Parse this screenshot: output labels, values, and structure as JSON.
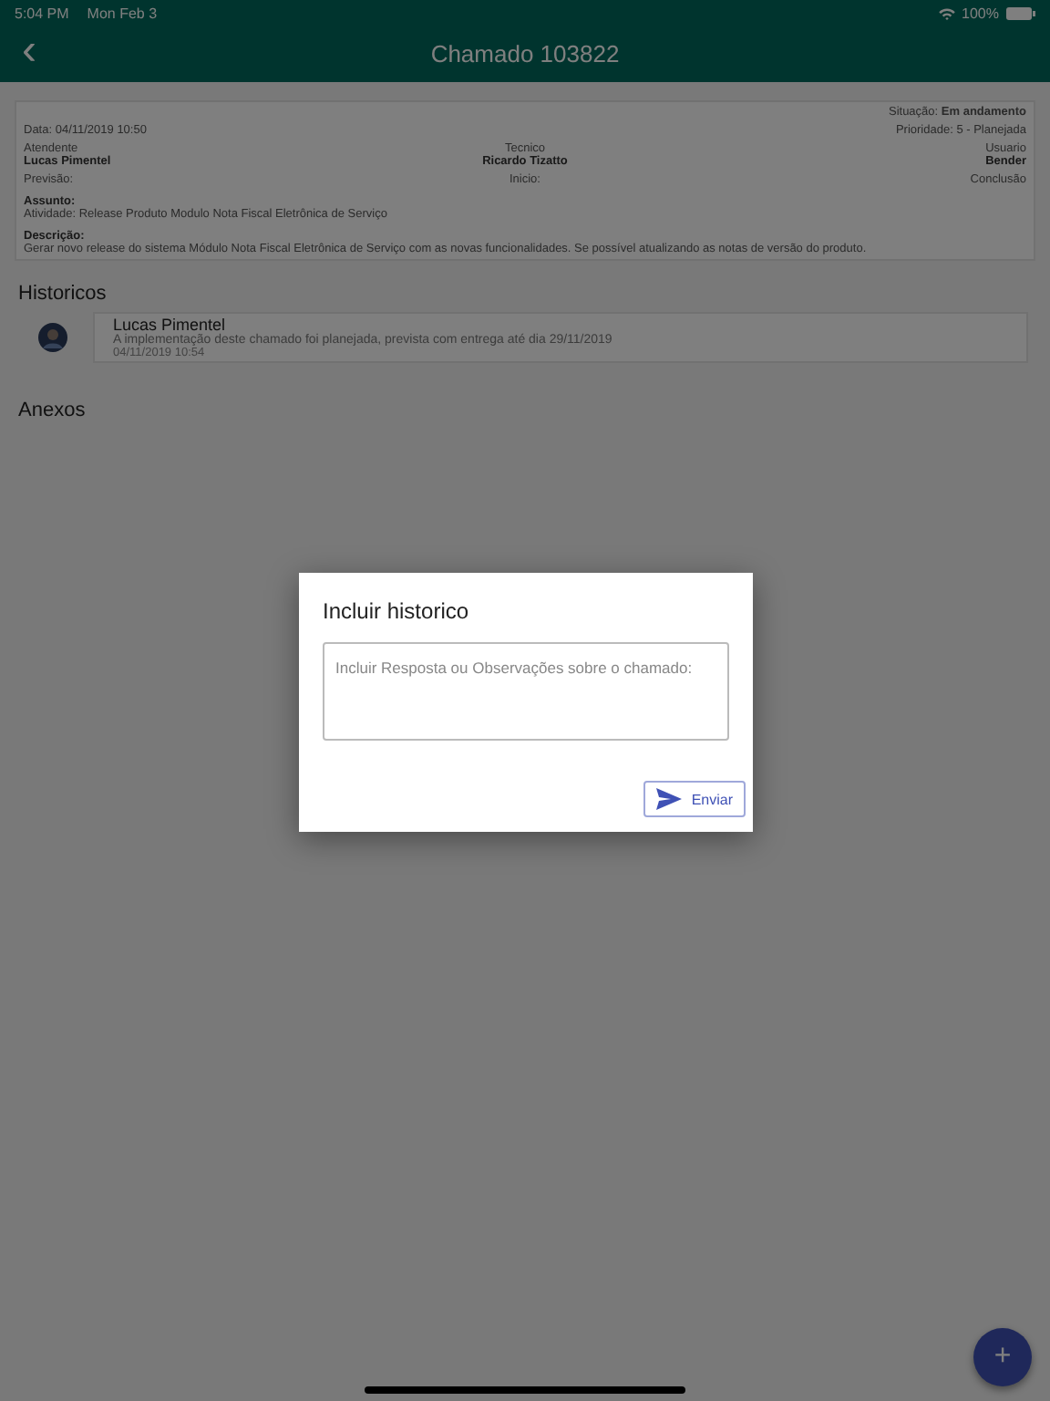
{
  "status_bar": {
    "time": "5:04 PM",
    "date": "Mon Feb 3",
    "battery": "100%"
  },
  "header": {
    "back": "‹",
    "title": "Chamado 103822"
  },
  "details": {
    "situacao": "Situação: **Em andamento**",
    "data": "Data: 04/11/2019 10:50",
    "prioridade": "Prioridade: 5 - Planejada",
    "people": [
      {
        "label": "Atendente",
        "value": "Lucas Pimentel"
      },
      {
        "label": "Tecnico",
        "value": "Ricardo Tizatto"
      },
      {
        "label": "Usuario",
        "value": "Bender"
      }
    ],
    "dates": [
      "Previsão:",
      "Inicio:",
      "Conclusão"
    ],
    "assunto_label": "Assunto:",
    "assunto": "Atividade: Release Produto Modulo Nota Fiscal Eletrônica de Serviço",
    "descricao_label": "Descrição:",
    "descricao": "Gerar novo release do sistema Módulo Nota Fiscal Eletrônica de Serviço com as novas funcionalidades. Se possível atualizando as notas de versão do produto."
  },
  "historicos": {
    "title": "Historicos",
    "items": [
      {
        "author": "Lucas Pimentel",
        "text": "A implementação deste chamado foi planejada, prevista com entrega até dia 29/11/2019",
        "date": "04/11/2019 10:54"
      }
    ]
  },
  "anexos": {
    "title": "Anexos"
  },
  "dialog": {
    "title": "Incluir historico",
    "placeholder": "Incluir Resposta ou Observações sobre o chamado:",
    "button": "Enviar"
  },
  "fab": "+"
}
